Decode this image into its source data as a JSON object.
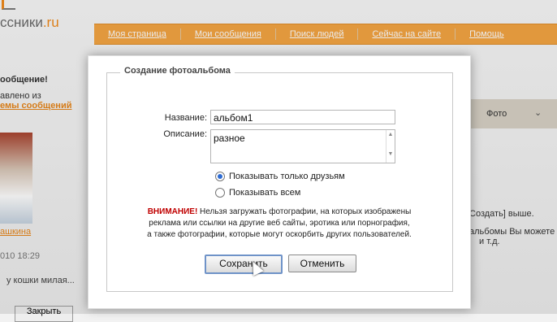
{
  "site": {
    "logo_main": "ссники",
    "logo_tld": ".ru"
  },
  "nav": [
    "Моя страница",
    "Мои сообщения",
    "Поиск людей",
    "Сейчас на сайте",
    "Помощь"
  ],
  "left": {
    "line1": "ообщение!",
    "line2": "авлено из",
    "line3": "емы сообщений",
    "caption": "ашкина",
    "date": "010 18:29",
    "quote": "у кошки милая...",
    "close_button": "Закрыть"
  },
  "right": {
    "dropdown": "Фото",
    "line1": "Создать] выше.",
    "line2": "альбомы Вы можете",
    "line3": "и т.д."
  },
  "dialog": {
    "title": "Создание фотоальбома",
    "name_label": "Название:",
    "name_value": "альбом1",
    "desc_label": "Описание:",
    "desc_value": "разное",
    "radio_options": [
      {
        "label": "Показывать только друзьям",
        "checked": true
      },
      {
        "label": "Показывать всем",
        "checked": false
      }
    ],
    "warning_prefix": "ВНИМАНИЕ!",
    "warning_line1": " Нельзя загружать фотографии, на которых изображены",
    "warning_line2": "реклама или ссылки на другие веб сайты, эротика или порнография,",
    "warning_line3": "а также фотографии, которые могут оскорбить других пользователей.",
    "save_button": "Сохранить",
    "cancel_button": "Отменить"
  },
  "colors": {
    "accent": "#f5a543",
    "warning": "#c00000",
    "link": "#e8861a"
  }
}
